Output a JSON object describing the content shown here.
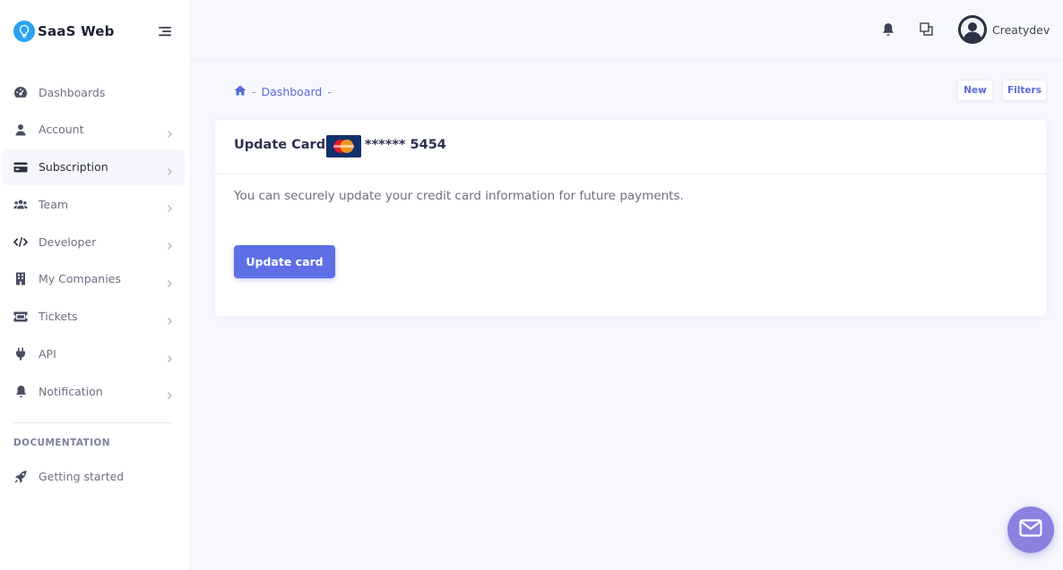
{
  "brand": {
    "name": "SaaS Web"
  },
  "sidebar": {
    "items": [
      {
        "label": "Dashboards",
        "icon": "dashboard-gauge-icon",
        "chevron": false
      },
      {
        "label": "Account",
        "icon": "user-icon",
        "chevron": true
      },
      {
        "label": "Subscription",
        "icon": "credit-card-icon",
        "chevron": true,
        "active": true
      },
      {
        "label": "Team",
        "icon": "users-icon",
        "chevron": true
      },
      {
        "label": "Developer",
        "icon": "code-icon",
        "chevron": true
      },
      {
        "label": "My Companies",
        "icon": "building-icon",
        "chevron": true
      },
      {
        "label": "Tickets",
        "icon": "ticket-icon",
        "chevron": true
      },
      {
        "label": "API",
        "icon": "plug-icon",
        "chevron": true
      },
      {
        "label": "Notification",
        "icon": "bell-icon",
        "chevron": true
      }
    ],
    "section_title": "DOCUMENTATION",
    "doc_item": {
      "label": "Getting started",
      "icon": "rocket-icon"
    }
  },
  "header": {
    "username": "Creatydev",
    "icons": [
      "bell-icon",
      "windows-icon",
      "avatar"
    ]
  },
  "breadcrumb": {
    "home_icon": "home-icon",
    "separator": "-",
    "current": "Dashboard"
  },
  "toolbar": {
    "new_label": "New",
    "filters_label": "Filters"
  },
  "card": {
    "title": "Update Card :",
    "card_brand": "Mastercard",
    "card_number": "****** 5454",
    "description": "You can securely update your credit card information for future payments.",
    "button_label": "Update card"
  },
  "fab": {
    "icon": "envelope-icon"
  },
  "colors": {
    "accent": "#5e6ee6",
    "link": "#5a6ad8",
    "fab": "#8c80e0",
    "logo": "#2aa3f3"
  }
}
